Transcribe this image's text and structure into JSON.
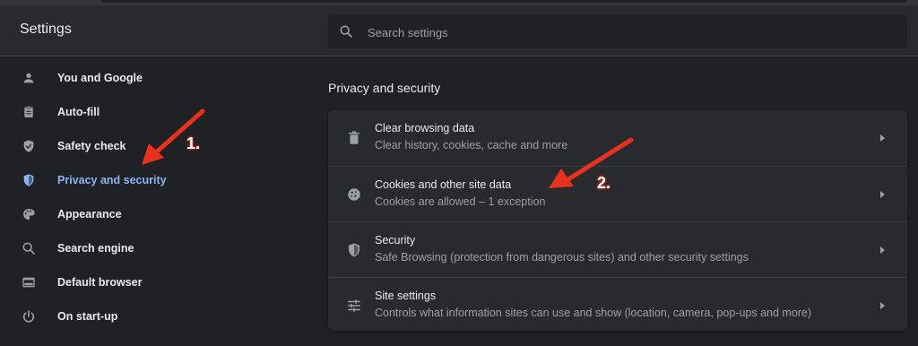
{
  "header": {
    "title": "Settings"
  },
  "search": {
    "placeholder": "Search settings",
    "icon": "search-icon"
  },
  "sidebar": {
    "items": [
      {
        "label": "You and Google",
        "icon": "person-icon"
      },
      {
        "label": "Auto-fill",
        "icon": "clipboard-icon"
      },
      {
        "label": "Safety check",
        "icon": "shield-check-icon"
      },
      {
        "label": "Privacy and security",
        "icon": "shield-icon",
        "active": true
      },
      {
        "label": "Appearance",
        "icon": "palette-icon"
      },
      {
        "label": "Search engine",
        "icon": "search-icon"
      },
      {
        "label": "Default browser",
        "icon": "browser-icon"
      },
      {
        "label": "On start-up",
        "icon": "power-icon"
      }
    ]
  },
  "main": {
    "section_title": "Privacy and security",
    "rows": [
      {
        "title": "Clear browsing data",
        "subtitle": "Clear history, cookies, cache and more",
        "icon": "trash-icon"
      },
      {
        "title": "Cookies and other site data",
        "subtitle": "Cookies are allowed – 1 exception",
        "icon": "cookie-icon"
      },
      {
        "title": "Security",
        "subtitle": "Safe Browsing (protection from dangerous sites) and other security settings",
        "icon": "shield-icon"
      },
      {
        "title": "Site settings",
        "subtitle": "Controls what information sites can use and show (location, camera, pop-ups and more)",
        "icon": "tune-icon"
      }
    ]
  },
  "annotations": {
    "marker1": "1.",
    "marker2": "2."
  },
  "colors": {
    "active": "#8ab4f8",
    "annotation": "#e8321d",
    "background": "#202124",
    "card": "#292a2d"
  }
}
